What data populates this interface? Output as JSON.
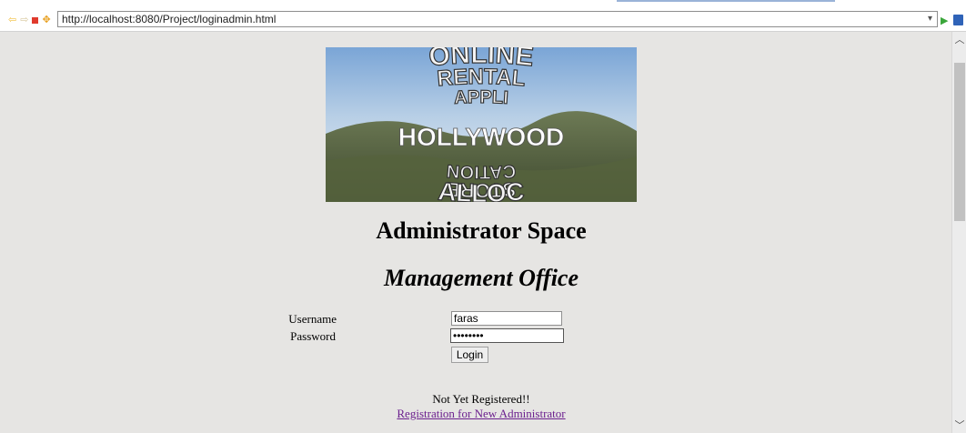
{
  "browser": {
    "url": "http://localhost:8080/Project/loginadmin.html"
  },
  "banner": {
    "arc_lines": [
      "ONLINE",
      "RENTAL",
      "APPLI",
      "CATION",
      "STORE",
      "ALLOC"
    ],
    "sign_text": "HOLLYWOOD"
  },
  "page": {
    "title": "Administrator Space",
    "subtitle": "Management Office"
  },
  "form": {
    "username_label": "Username",
    "username_value": "faras",
    "password_label": "Password",
    "password_value": "••••••••",
    "login_label": "Login"
  },
  "footer": {
    "not_registered": "Not Yet Registered!!",
    "register_link": "Registration for New Administrator"
  }
}
